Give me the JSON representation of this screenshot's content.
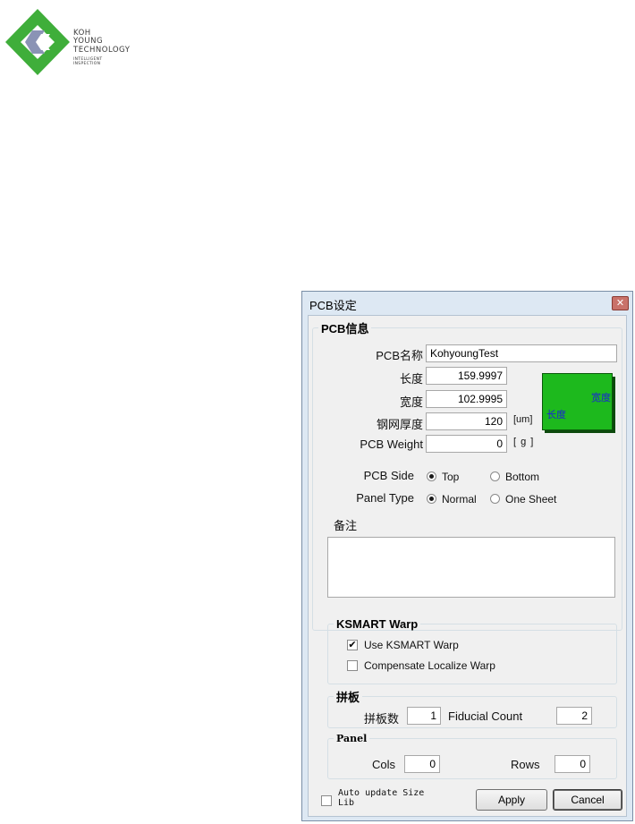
{
  "logo": {
    "line1": "KOH",
    "line2": "YOUNG",
    "line3": "TECHNOLOGY",
    "line4": "INTELLIGENT",
    "line5": "INSPECTION"
  },
  "dialog": {
    "title": "PCB设定",
    "close_label": "✕"
  },
  "pcb_info": {
    "legend": "PCB信息",
    "name_label": "PCB名称",
    "name_value": "KohyoungTest",
    "length_label": "长度",
    "length_value": "159.9997",
    "width_label": "宽度",
    "width_value": "102.9995",
    "stencil_label": "钢网厚度",
    "stencil_value": "120",
    "stencil_unit": "[um]",
    "weight_label": "PCB Weight",
    "weight_value": "0",
    "weight_unit": "[ g ]",
    "preview_width_label": "宽度",
    "preview_length_label": "长度",
    "preview_color": "#1db91d",
    "preview_text_color": "#1a23d6",
    "side_label": "PCB Side",
    "side_options": [
      "Top",
      "Bottom"
    ],
    "side_selected": "Top",
    "panel_type_label": "Panel Type",
    "panel_type_options": [
      "Normal",
      "One Sheet"
    ],
    "panel_type_selected": "Normal",
    "remark_label": "备注",
    "remark_value": ""
  },
  "ksmart": {
    "legend": "KSMART Warp",
    "use_warp_label": "Use KSMART Warp",
    "use_warp_checked": true,
    "compensate_label": "Compensate Localize Warp",
    "compensate_checked": false
  },
  "panelize": {
    "legend": "拼板",
    "count_label": "拼板数",
    "count_value": "1",
    "fiducial_label": "Fiducial Count",
    "fiducial_value": "2"
  },
  "panel": {
    "legend": "Panel",
    "cols_label": "Cols",
    "cols_value": "0",
    "rows_label": "Rows",
    "rows_value": "0"
  },
  "footer": {
    "auto_update_label": "Auto update Size Lib",
    "auto_update_checked": false,
    "apply_label": "Apply",
    "cancel_label": "Cancel"
  }
}
